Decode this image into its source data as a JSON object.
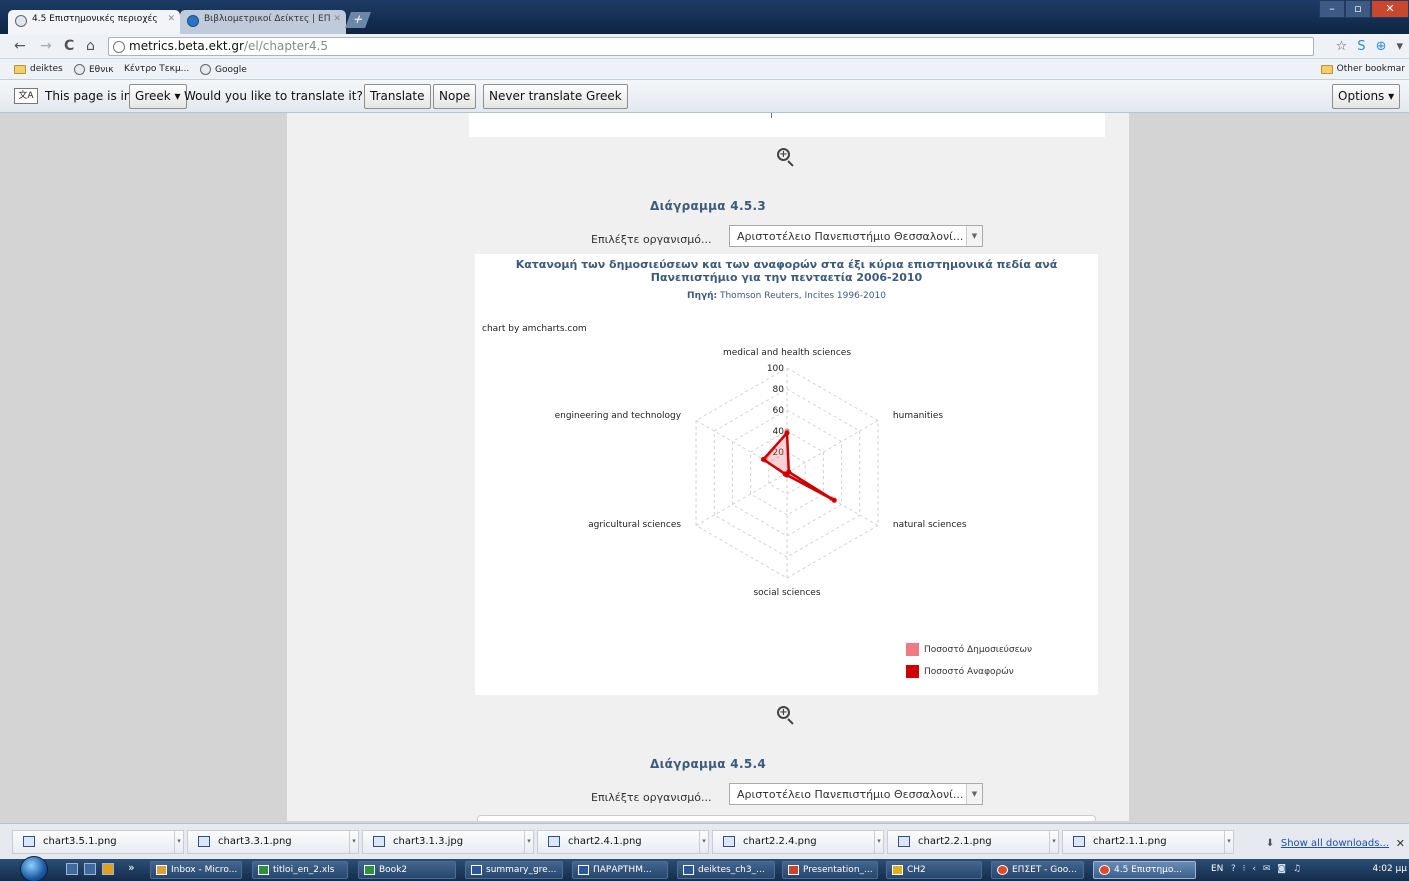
{
  "browser": {
    "tabs": [
      {
        "label": "4.5 Επιστημονικές περιοχές",
        "active": true
      },
      {
        "label": "Βιβλιομετρικοί Δείκτες | ΕΠ",
        "active": false
      }
    ],
    "new_tab_symbol": "+",
    "window_controls": {
      "minimize": "–",
      "maximize": "▫",
      "close": "✕"
    },
    "nav": {
      "back": "←",
      "forward": "→",
      "reload": "C",
      "home": "⌂"
    },
    "url_host": "metrics.beta.ekt.gr",
    "url_path": "/el/chapter4.5",
    "toolbar_right": {
      "star": "☆",
      "ext1": "S",
      "ext2": "⊕",
      "menu": "▾"
    }
  },
  "bookmarks": {
    "items": [
      "deiktes",
      "Εθνικ",
      "Κέντρο Τεκμ...",
      "Google"
    ],
    "other": "Other bookmar"
  },
  "translate_bar": {
    "icon_text": "文A",
    "prefix": "This page is in",
    "language": "Greek ▾",
    "question": "Would you like to translate it?",
    "translate_btn": "Translate",
    "nope_btn": "Nope",
    "never_btn": "Never translate Greek",
    "options_btn": "Options ▾"
  },
  "content": {
    "zoom_symbol": "+",
    "diagram1": {
      "heading": "Διάγραμμα 4.5.3",
      "select_label": "Επιλέξτε οργανισμό...",
      "select_value": "Αριστοτέλειο Πανεπιστήμιο Θεσσαλονί...",
      "select_arrow": "▼"
    },
    "diagram2": {
      "heading": "Διάγραμμα 4.5.4",
      "select_label": "Επιλέξτε οργανισμό...",
      "select_value": "Αριστοτέλειο Πανεπιστήμιο Θεσσαλονί...",
      "select_arrow": "▼"
    }
  },
  "chart_data": {
    "type": "radar",
    "title_line1": "Κατανομή των δημοσιεύσεων και των αναφορών στα έξι κύρια επιστημονικά πεδία ανά",
    "title_line2": "Πανεπιστήμιο για την πενταετία 2006-2010",
    "source_label": "Πηγή:",
    "source_value": "Thomson Reuters, Incites 1996-2010",
    "credit": "chart by amcharts.com",
    "axes": [
      "medical and health sciences",
      "humanities",
      "natural sciences",
      "social sciences",
      "agricultural sciences",
      "engineering and technology"
    ],
    "ticks": [
      100,
      80,
      60,
      40,
      20
    ],
    "range": [
      0,
      100
    ],
    "grid": true,
    "legend_position": "bottom-right",
    "series": [
      {
        "name": "Ποσοστό Δημοσιεύσεων",
        "color": "#f07a84",
        "values": [
          40,
          2,
          49,
          2,
          2,
          24
        ]
      },
      {
        "name": "Ποσοστό Αναφορών",
        "color": "#cc0000",
        "values": [
          38,
          2,
          52,
          2,
          2,
          26
        ]
      }
    ]
  },
  "downloads": {
    "items": [
      "chart3.5.1.png",
      "chart3.3.1.png",
      "chart3.1.3.jpg",
      "chart2.4.1.png",
      "chart2.2.4.png",
      "chart2.2.1.png",
      "chart2.1.1.png"
    ],
    "show_all": "Show all downloads...",
    "close": "✕",
    "arrow": "▾",
    "show_all_icon": "⬇"
  },
  "taskbar": {
    "items": [
      {
        "label": "Inbox - Micro...",
        "active": false
      },
      {
        "label": "titloi_en_2.xls",
        "active": false
      },
      {
        "label": "Book2",
        "active": false
      },
      {
        "label": "summary_gre...",
        "active": false
      },
      {
        "label": "ΠΑΡΑΡΤΗΜ...",
        "active": false
      },
      {
        "label": "deiktes_ch3_...",
        "active": false
      },
      {
        "label": "Presentation_...",
        "active": false
      },
      {
        "label": "CH2",
        "active": false
      },
      {
        "label": "ΕΠΣΕΤ - Goo...",
        "active": false
      },
      {
        "label": "4.5 Επιστημο...",
        "active": true
      }
    ],
    "overflow": "»",
    "lang": "EN",
    "tray_icons": "? ⁝ ‹ ✉ ◙ ♫",
    "time": "4:02 μμ"
  }
}
